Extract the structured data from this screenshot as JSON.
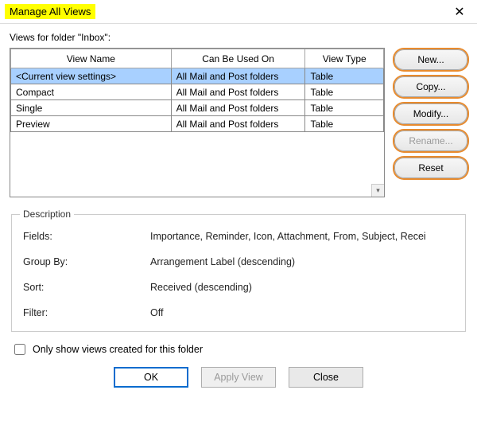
{
  "window": {
    "title": "Manage All Views",
    "close_glyph": "✕"
  },
  "folder_label": "Views for folder \"Inbox\":",
  "table": {
    "headers": {
      "name": "View Name",
      "used_on": "Can Be Used On",
      "type": "View Type"
    },
    "rows": [
      {
        "name": "<Current view settings>",
        "used_on": "All Mail and Post folders",
        "type": "Table",
        "selected": true
      },
      {
        "name": "Compact",
        "used_on": "All Mail and Post folders",
        "type": "Table",
        "selected": false
      },
      {
        "name": "Single",
        "used_on": "All Mail and Post folders",
        "type": "Table",
        "selected": false
      },
      {
        "name": "Preview",
        "used_on": "All Mail and Post folders",
        "type": "Table",
        "selected": false
      }
    ]
  },
  "side_buttons": {
    "new": "New...",
    "copy": "Copy...",
    "modify": "Modify...",
    "rename": "Rename...",
    "reset": "Reset"
  },
  "description": {
    "legend": "Description",
    "fields_label": "Fields:",
    "fields_value": "Importance, Reminder, Icon, Attachment, From, Subject, Recei",
    "group_label": "Group By:",
    "group_value": "Arrangement Label (descending)",
    "sort_label": "Sort:",
    "sort_value": "Received (descending)",
    "filter_label": "Filter:",
    "filter_value": "Off"
  },
  "only_checkbox_label": "Only show views created for this folder",
  "bottom": {
    "ok": "OK",
    "apply": "Apply View",
    "close": "Close"
  }
}
